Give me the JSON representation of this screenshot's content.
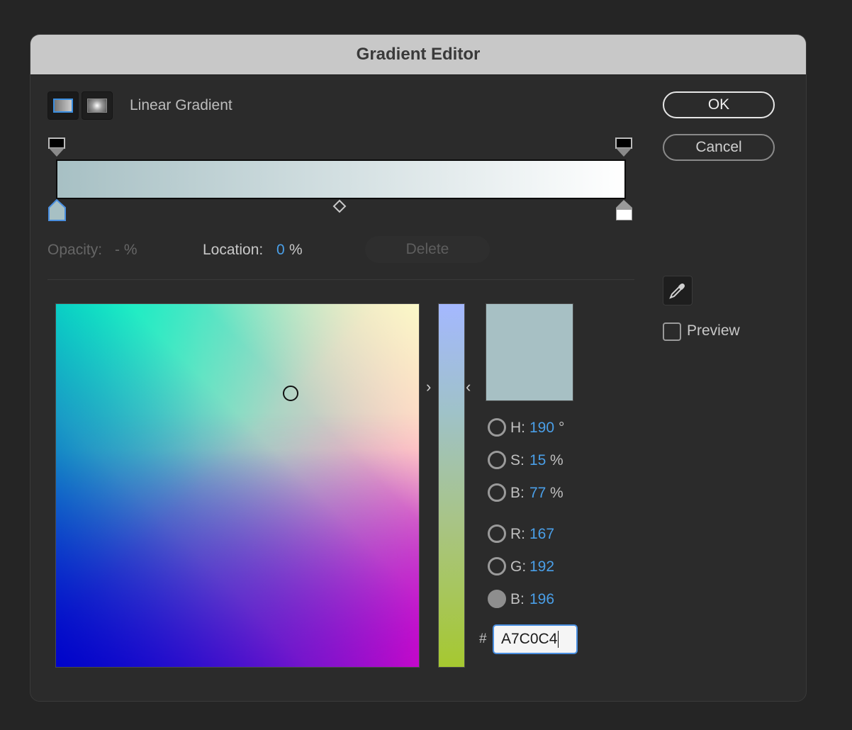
{
  "dialog": {
    "title": "Gradient Editor",
    "gradient_type_label": "Linear Gradient",
    "ok_label": "OK",
    "cancel_label": "Cancel"
  },
  "gradient": {
    "start_color": "#a7c0c4",
    "end_color": "#ffffff"
  },
  "stop_row": {
    "opacity_label": "Opacity:",
    "opacity_value": "- %",
    "location_label": "Location:",
    "location_value": "0",
    "location_unit": "%",
    "delete_label": "Delete"
  },
  "color": {
    "current_swatch": "#a7c0c4",
    "h_label": "H:",
    "h_value": "190",
    "h_unit": "°",
    "s_label": "S:",
    "s_value": "15",
    "s_unit": "%",
    "b_label": "B:",
    "b_value": "77",
    "b_unit": "%",
    "r_label": "R:",
    "r_value": "167",
    "g_label": "G:",
    "g_value": "192",
    "bl_label": "B:",
    "bl_value": "196",
    "hex_prefix": "#",
    "hex_value": "A7C0C4"
  },
  "preview_label": "Preview",
  "icons": [
    "linear-gradient-icon",
    "radial-gradient-icon",
    "eyedropper-icon"
  ]
}
